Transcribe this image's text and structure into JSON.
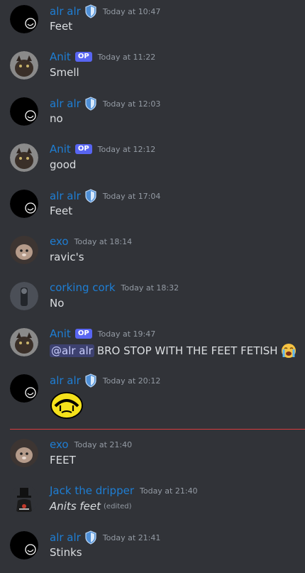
{
  "messages": [
    {
      "author": "alr alr",
      "time": "Today at 10:47",
      "text": "Feet"
    },
    {
      "author": "Anit",
      "op": "OP",
      "time": "Today at 11:22",
      "text": "Smell"
    },
    {
      "author": "alr alr",
      "time": "Today at 12:03",
      "text": "no"
    },
    {
      "author": "Anit",
      "op": "OP",
      "time": "Today at 12:12",
      "text": "good"
    },
    {
      "author": "alr alr",
      "time": "Today at 17:04",
      "text": "Feet"
    },
    {
      "author": "exo",
      "time": "Today at 18:14",
      "text": "ravic's"
    },
    {
      "author": "corking cork",
      "time": "Today at 18:32",
      "text": "No"
    },
    {
      "author": "Anit",
      "op": "OP",
      "time": "Today at 19:47",
      "mention": "@alr alr",
      "text": "BRO STOP WITH THE FEET FETISH"
    },
    {
      "author": "alr alr",
      "time": "Today at 20:12"
    },
    {
      "author": "exo",
      "time": "Today at 21:40",
      "text": "FEET"
    },
    {
      "author": "Jack the dripper",
      "time": "Today at 21:40",
      "text": "Anits feet",
      "edited": "(edited)"
    },
    {
      "author": "alr alr",
      "time": "Today at 21:41",
      "text": "Stinks"
    }
  ],
  "colors": {
    "background": "#313338",
    "author_name": "#1e7ed4",
    "op_badge": "#5865f2",
    "new_messages_divider": "#d83c3e"
  },
  "icons": {
    "shield": "shield-badge-icon",
    "crying_emoji": "loudly-crying-face-icon",
    "sad_custom_emoji": "yellow-sad-face-emoji"
  }
}
